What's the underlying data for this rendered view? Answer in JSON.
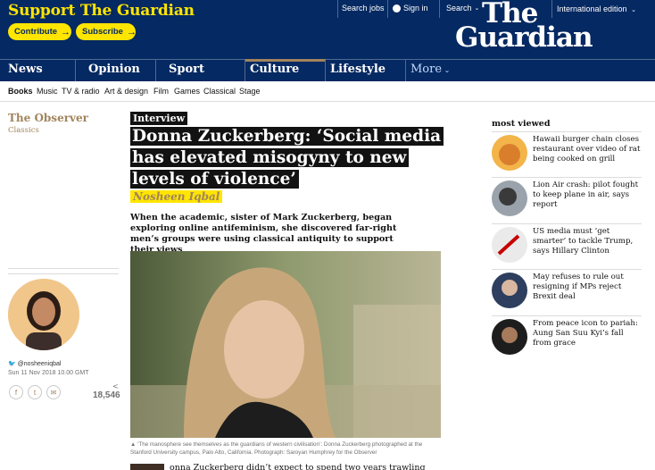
{
  "header": {
    "support_title": "Support The Guardian",
    "contribute_label": "Contribute",
    "subscribe_label": "Subscribe",
    "search_jobs": "Search jobs",
    "sign_in": "Sign in",
    "search": "Search",
    "logo_line1": "The",
    "logo_line2": "Guardian",
    "edition": "International edition"
  },
  "nav": {
    "news": "News",
    "opinion": "Opinion",
    "sport": "Sport",
    "culture": "Culture",
    "lifestyle": "Lifestyle",
    "more": "More"
  },
  "subnav": [
    "Books",
    "Music",
    "TV & radio",
    "Art & design",
    "Film",
    "Games",
    "Classical",
    "Stage"
  ],
  "left": {
    "section": "The Observer",
    "series": "Classics",
    "twitter": "@nosheeniqbal",
    "date": "Sun 11 Nov 2018 10.00 GMT",
    "share_count": "18,546"
  },
  "article": {
    "kicker": "Interview",
    "headline": "Donna Zuckerberg: ‘Social media has elevated misogyny to new levels of violence’",
    "byline": "Nosheen Iqbal",
    "standfirst": "When the academic, sister of Mark Zuckerberg, began exploring online antifeminism, she discovered far-right men’s groups were using classical antiquity to support their views",
    "caption": "▲ ‘The manosphere see themselves as the guardians of western civilisation’: Donna Zuckerberg photographed at the Stanford University campus, Palo Alto, California. Photograph: Saroyan Humphrey for the Observer",
    "body_start": "onna Zuckerberg didn’t expect to spend two years trawling"
  },
  "most_viewed": {
    "title": "most viewed",
    "items": [
      {
        "headline": "Hawaii burger chain closes restaurant over video of rat being cooked on grill"
      },
      {
        "headline": "Lion Air crash: pilot fought to keep plane in air, says report"
      },
      {
        "headline": "US media must ‘get smarter’ to tackle Trump, says Hillary Clinton"
      },
      {
        "headline": "May refuses to rule out resigning if MPs reject Brexit deal"
      },
      {
        "headline": "From peace icon to pariah: Aung San Suu Kyi’s fall from grace"
      }
    ]
  },
  "colors": {
    "brand_navy": "#052962",
    "support_yellow": "#ffe500",
    "culture_accent": "#a1845c"
  }
}
